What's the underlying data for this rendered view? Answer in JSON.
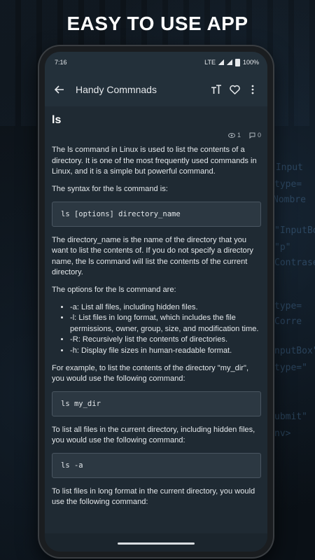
{
  "headline": "EASY TO USE APP",
  "background_code": [
    "\"Input",
    "type=",
    "Nombre",
    "\"InputBo",
    "\"p\"",
    "Contrase",
    "type=",
    "Corre",
    "nputBox\"",
    "type=\"",
    "ubmit\"",
    "nv>"
  ],
  "status_bar": {
    "time": "7:16",
    "network": "LTE",
    "battery": "100%"
  },
  "app_bar": {
    "title": "Handy Commnads",
    "back_icon": "arrow-left-icon",
    "text_size_icon": "text-size-icon",
    "favorite_icon": "heart-outline-icon",
    "menu_icon": "more-vertical-icon"
  },
  "article": {
    "title": "ls",
    "views": "1",
    "comments": "0",
    "intro": "The ls command in Linux is used to list the contents of a directory. It is one of the most frequently used commands in Linux, and it is a simple but powerful command.",
    "syntax_label": "The syntax for the ls command is:",
    "syntax_code": "ls [options] directory_name",
    "dirname_desc": "The directory_name is the name of the directory that you want to list the contents of. If you do not specify a directory name, the ls command will list the contents of the current directory.",
    "options_label": "The options for the ls command are:",
    "options": [
      "-a: List all files, including hidden files.",
      "-l: List files in long format, which includes the file permissions, owner, group, size, and modification time.",
      "-R: Recursively list the contents of directories.",
      "-h: Display file sizes in human-readable format."
    ],
    "example1_text": "For example, to list the contents of the directory \"my_dir\", you would use the following command:",
    "example1_code": "ls my_dir",
    "example2_text": "To list all files in the current directory, including hidden files, you would use the following command:",
    "example2_code": "ls -a",
    "example3_text": "To list files in long format in the current directory, you would use the following command:"
  },
  "colors": {
    "screen_bg": "#1f2a33",
    "appbar_bg": "#23303a",
    "code_bg": "#2c3842",
    "text": "#e3e7ea"
  }
}
